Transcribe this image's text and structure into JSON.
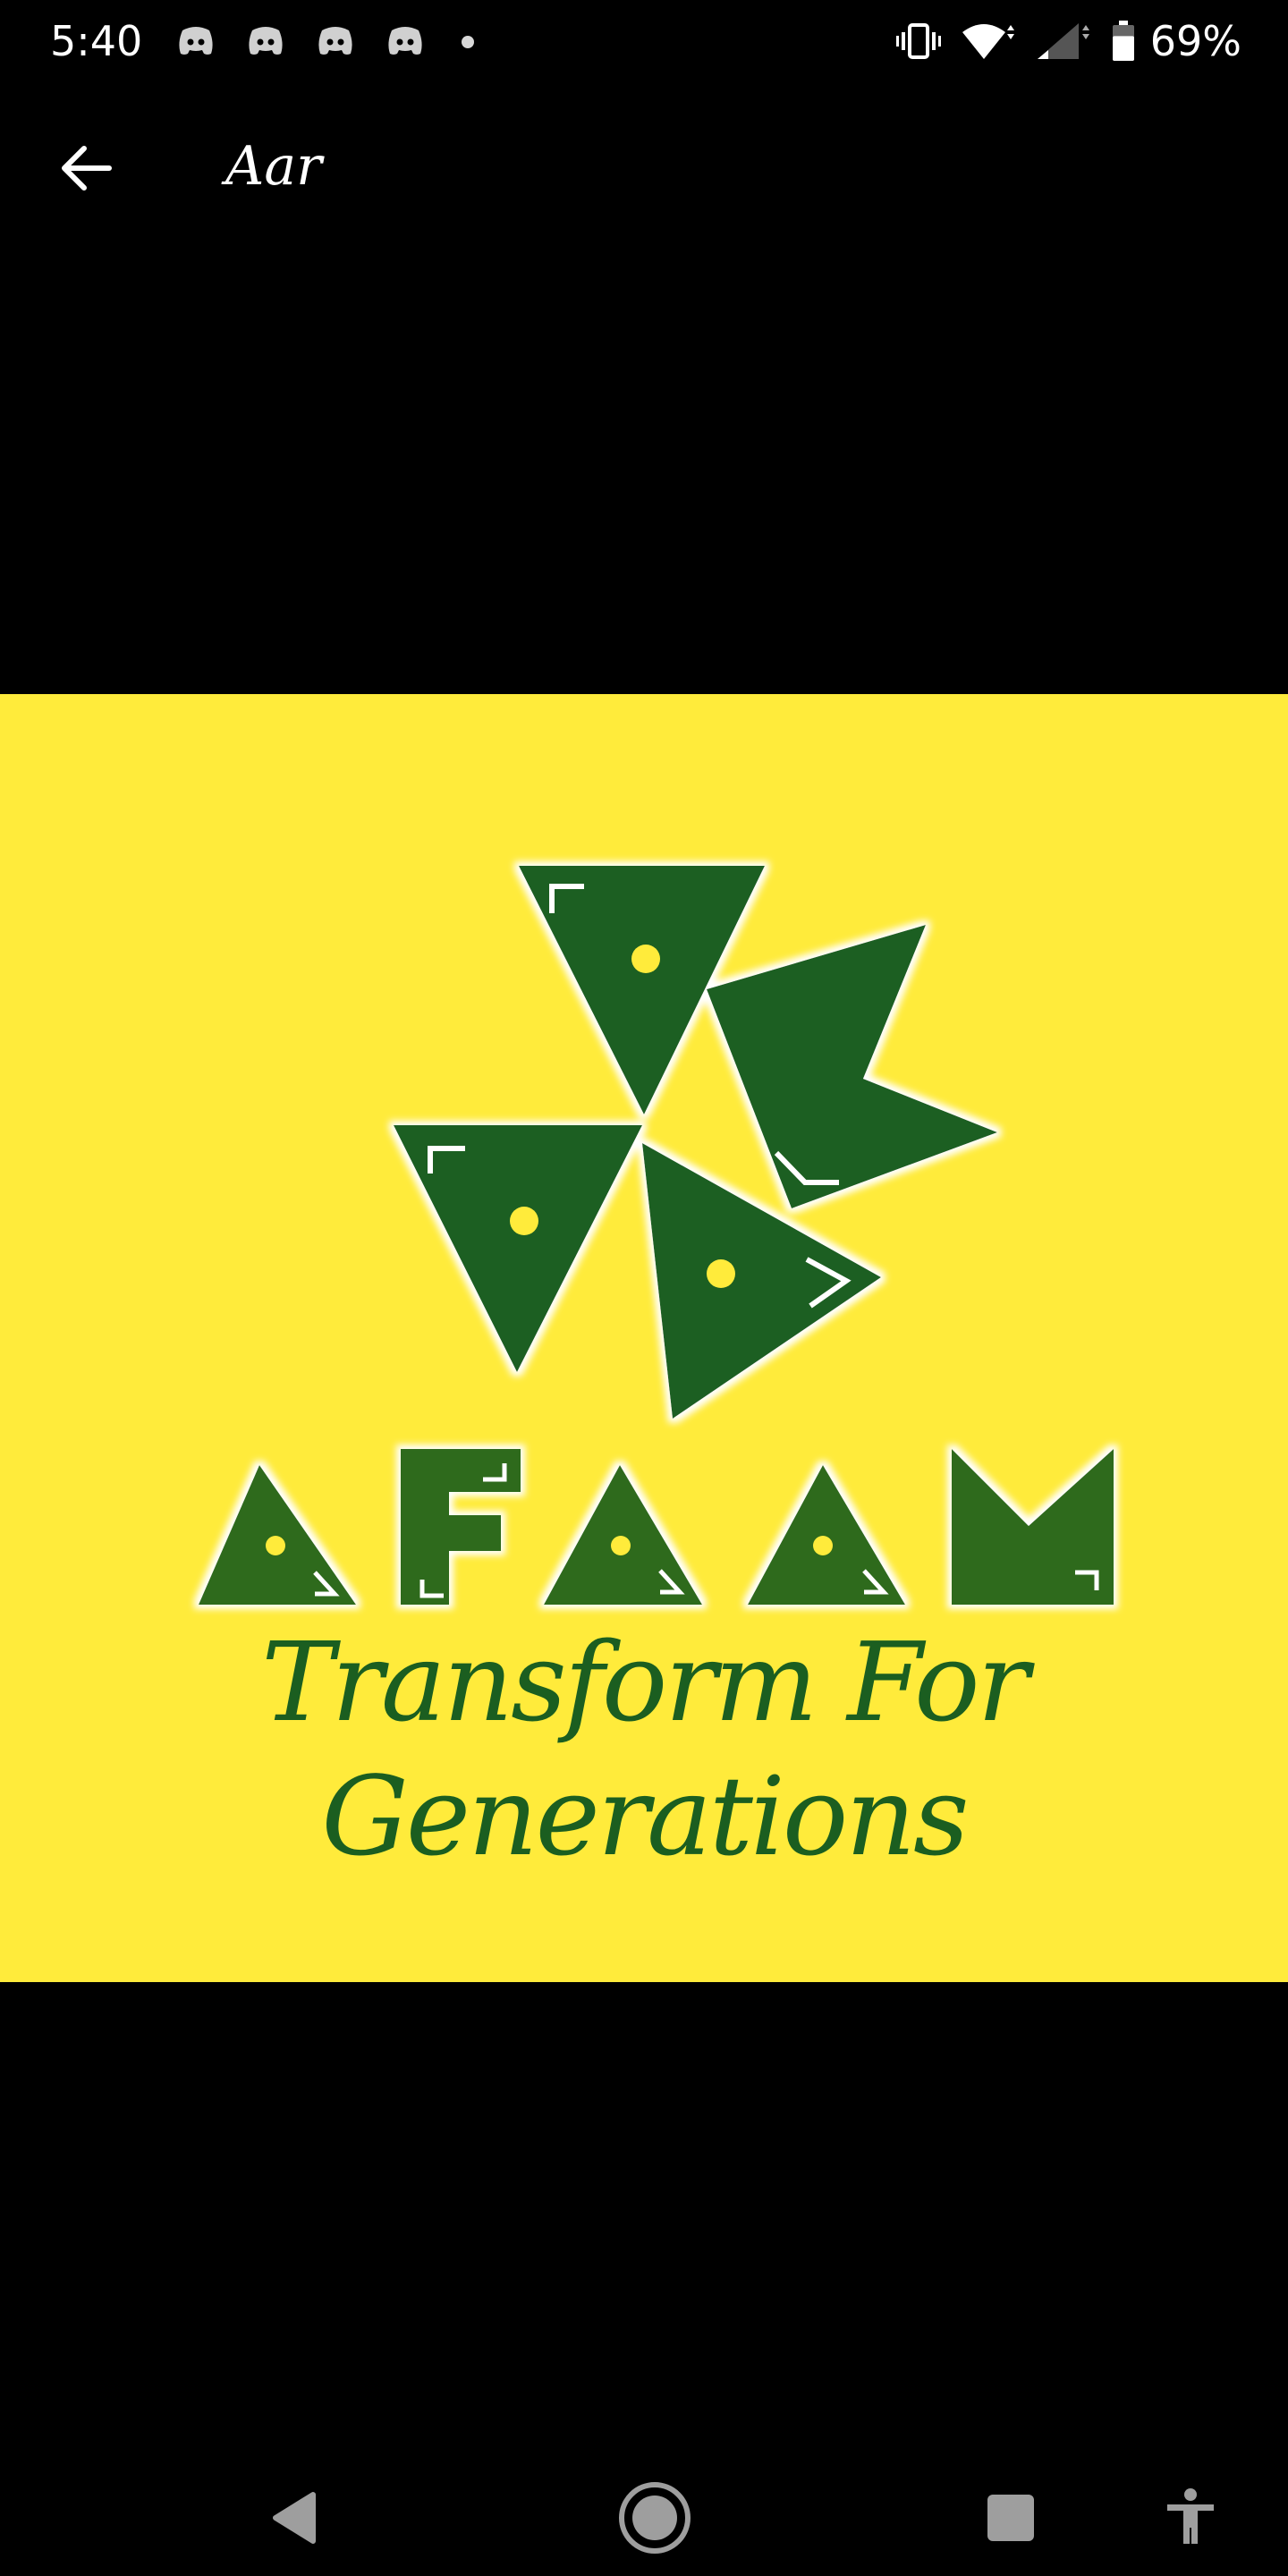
{
  "status_bar": {
    "time": "5:40",
    "notification_icons": [
      "discord-icon",
      "discord-icon",
      "discord-icon",
      "discord-icon"
    ],
    "more_notifications": "dot-icon",
    "system_icons": [
      "vibrate-icon",
      "wifi-icon",
      "signal-icon",
      "battery-icon"
    ],
    "battery_percent": "69%",
    "battery_level": 0.69
  },
  "app_bar": {
    "back_icon": "arrow-left-icon",
    "title": "Aar"
  },
  "image": {
    "background_color": "#ffeb3b",
    "logo_color": "#1b5e20",
    "logo_text": "AFAAM",
    "tagline": "Transform For Generations"
  },
  "nav_bar": {
    "back_icon": "triangle-back-icon",
    "home_icon": "circle-home-icon",
    "recents_icon": "square-recents-icon",
    "accessibility_icon": "accessibility-icon"
  }
}
